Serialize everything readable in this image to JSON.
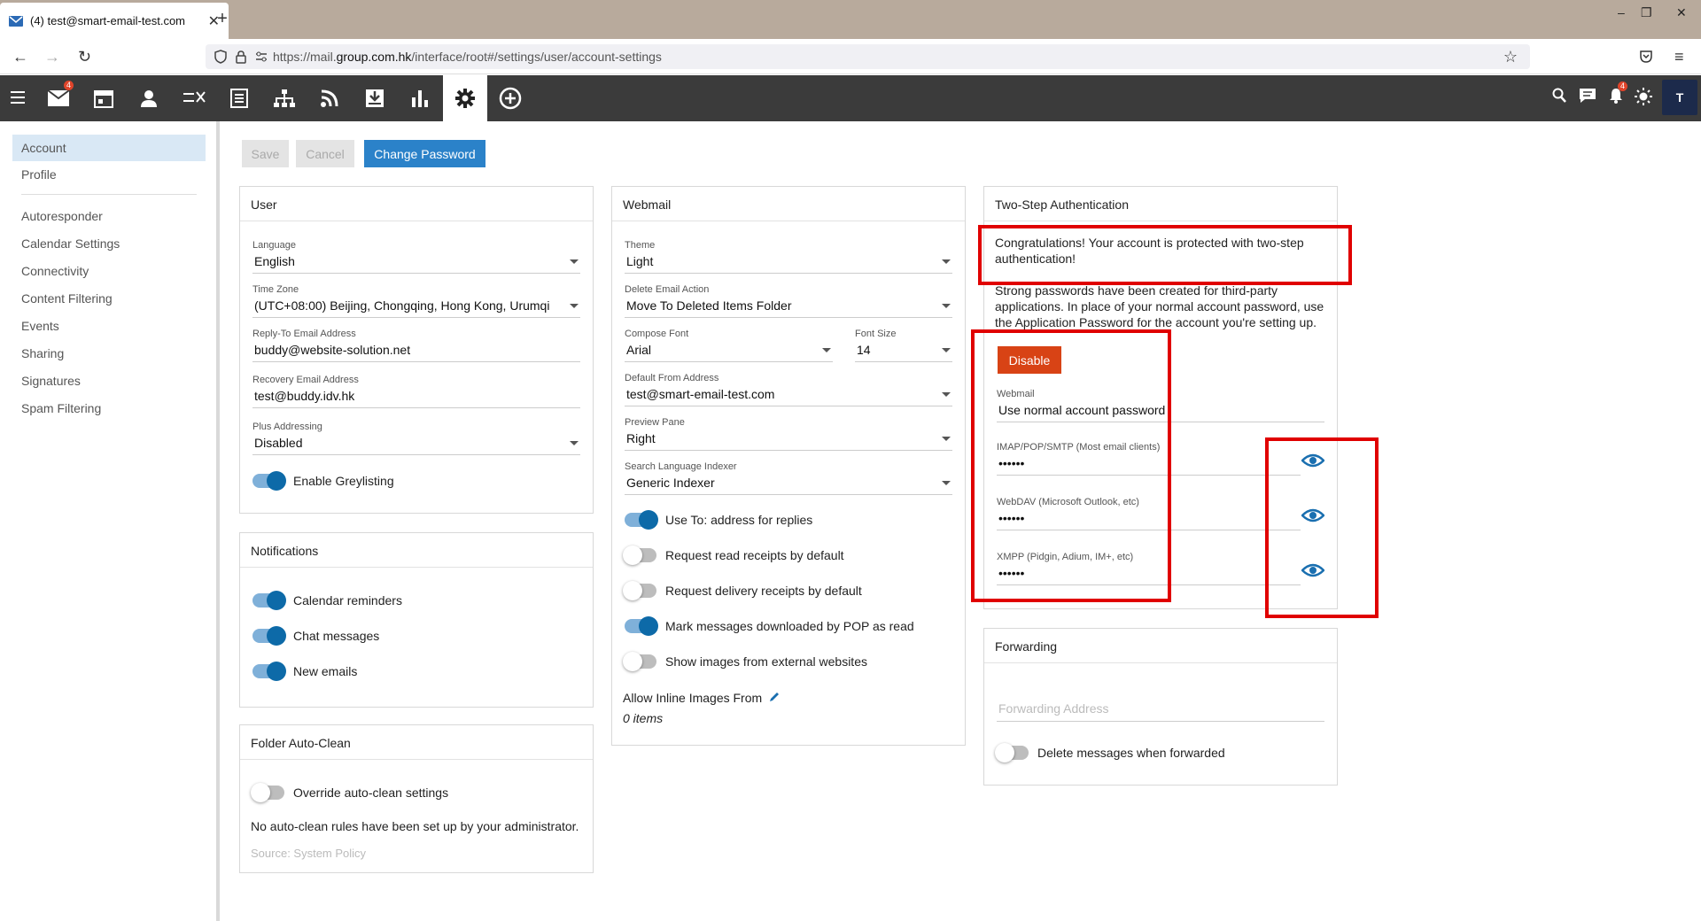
{
  "browser": {
    "tab_title": "(4) test@smart-email-test.com",
    "url_prefix": "https://mail.",
    "url_domain": "group.com.hk",
    "url_path": "/interface/root#/settings/user/account-settings"
  },
  "toolbar": {
    "mail_badge": "4",
    "notification_badge": "4",
    "avatar_letter": "T"
  },
  "sidebar": {
    "items": [
      {
        "label": "Account"
      },
      {
        "label": "Profile"
      },
      {
        "label": "Autoresponder"
      },
      {
        "label": "Calendar Settings"
      },
      {
        "label": "Connectivity"
      },
      {
        "label": "Content Filtering"
      },
      {
        "label": "Events"
      },
      {
        "label": "Sharing"
      },
      {
        "label": "Signatures"
      },
      {
        "label": "Spam Filtering"
      }
    ]
  },
  "actions": {
    "save": "Save",
    "cancel": "Cancel",
    "change_password": "Change Password"
  },
  "user": {
    "title": "User",
    "language_label": "Language",
    "language": "English",
    "timezone_label": "Time Zone",
    "timezone": "(UTC+08:00) Beijing, Chongqing, Hong Kong, Urumqi",
    "reply_label": "Reply-To Email Address",
    "reply": "buddy@website-solution.net",
    "recovery_label": "Recovery Email Address",
    "recovery": "test@buddy.idv.hk",
    "plus_label": "Plus Addressing",
    "plus": "Disabled",
    "greylisting": "Enable Greylisting"
  },
  "notifications": {
    "title": "Notifications",
    "calendar": "Calendar reminders",
    "chat": "Chat messages",
    "emails": "New emails"
  },
  "autoclean": {
    "title": "Folder Auto-Clean",
    "override": "Override auto-clean settings",
    "note": "No auto-clean rules have been set up by your administrator.",
    "source": "Source: System Policy"
  },
  "webmail": {
    "title": "Webmail",
    "theme_label": "Theme",
    "theme": "Light",
    "delete_label": "Delete Email Action",
    "delete": "Move To Deleted Items Folder",
    "font_label": "Compose Font",
    "font": "Arial",
    "size_label": "Font Size",
    "size": "14",
    "from_label": "Default From Address",
    "from": "test@smart-email-test.com",
    "preview_label": "Preview Pane",
    "preview": "Right",
    "indexer_label": "Search Language Indexer",
    "indexer": "Generic Indexer",
    "t_useto": "Use To: address for replies",
    "t_read": "Request read receipts by default",
    "t_delivery": "Request delivery receipts by default",
    "t_pop": "Mark messages downloaded by POP as read",
    "t_images": "Show images from external websites",
    "inline_label": "Allow Inline Images From",
    "inline_count": "0 items"
  },
  "twostep": {
    "title": "Two-Step Authentication",
    "congrats": "Congratulations! Your account is protected with two-step authentication!",
    "info": "Strong passwords have been created for third-party applications. In place of your normal account password, use the Application Password for the account you're setting up.",
    "disable": "Disable",
    "webmail_label": "Webmail",
    "webmail_value": "Use normal account password",
    "imap_label": "IMAP/POP/SMTP (Most email clients)",
    "imap_value": "••••••",
    "webdav_label": "WebDAV (Microsoft Outlook, etc)",
    "webdav_value": "••••••",
    "xmpp_label": "XMPP (Pidgin, Adium, IM+, etc)",
    "xmpp_value": "••••••"
  },
  "forwarding": {
    "title": "Forwarding",
    "placeholder": "Forwarding Address",
    "delete": "Delete messages when forwarded"
  }
}
